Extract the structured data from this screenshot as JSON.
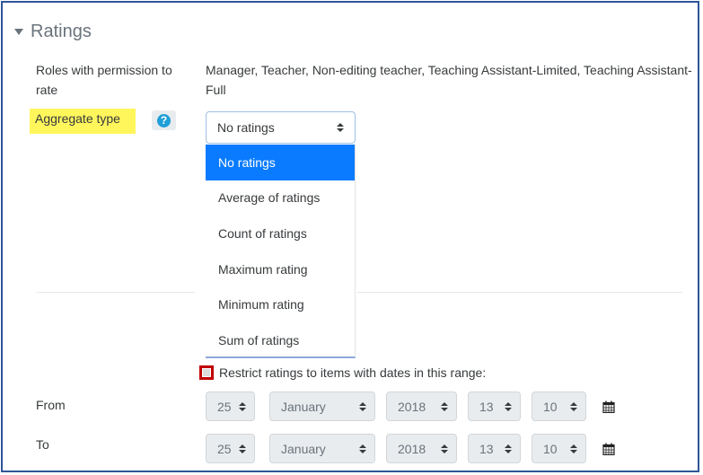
{
  "section": {
    "title": "Ratings"
  },
  "roles": {
    "label": "Roles with permission to rate",
    "value": "Manager, Teacher, Non-editing teacher, Teaching Assistant-Limited, Teaching Assistant-Full"
  },
  "aggregate": {
    "label": "Aggregate type",
    "help_icon_text": "?",
    "selected": "No ratings",
    "options": [
      "No ratings",
      "Average of ratings",
      "Count of ratings",
      "Maximum rating",
      "Minimum rating",
      "Sum of ratings"
    ]
  },
  "restrict": {
    "label": "Restrict ratings to items with dates in this range:"
  },
  "from": {
    "label": "From",
    "day": "25",
    "month": "January",
    "year": "2018",
    "hour": "13",
    "minute": "10"
  },
  "to": {
    "label": "To",
    "day": "25",
    "month": "January",
    "year": "2018",
    "hour": "13",
    "minute": "10"
  },
  "colors": {
    "highlight": "#fff65c",
    "selected_option": "#0a7bff",
    "help_icon": "#1f9fd7",
    "checkbox_outline": "#c00000",
    "frame": "#2f5597"
  },
  "icons": {
    "section_toggle": "caret-down-icon",
    "help": "question-circle-icon",
    "calendar": "calendar-icon"
  }
}
